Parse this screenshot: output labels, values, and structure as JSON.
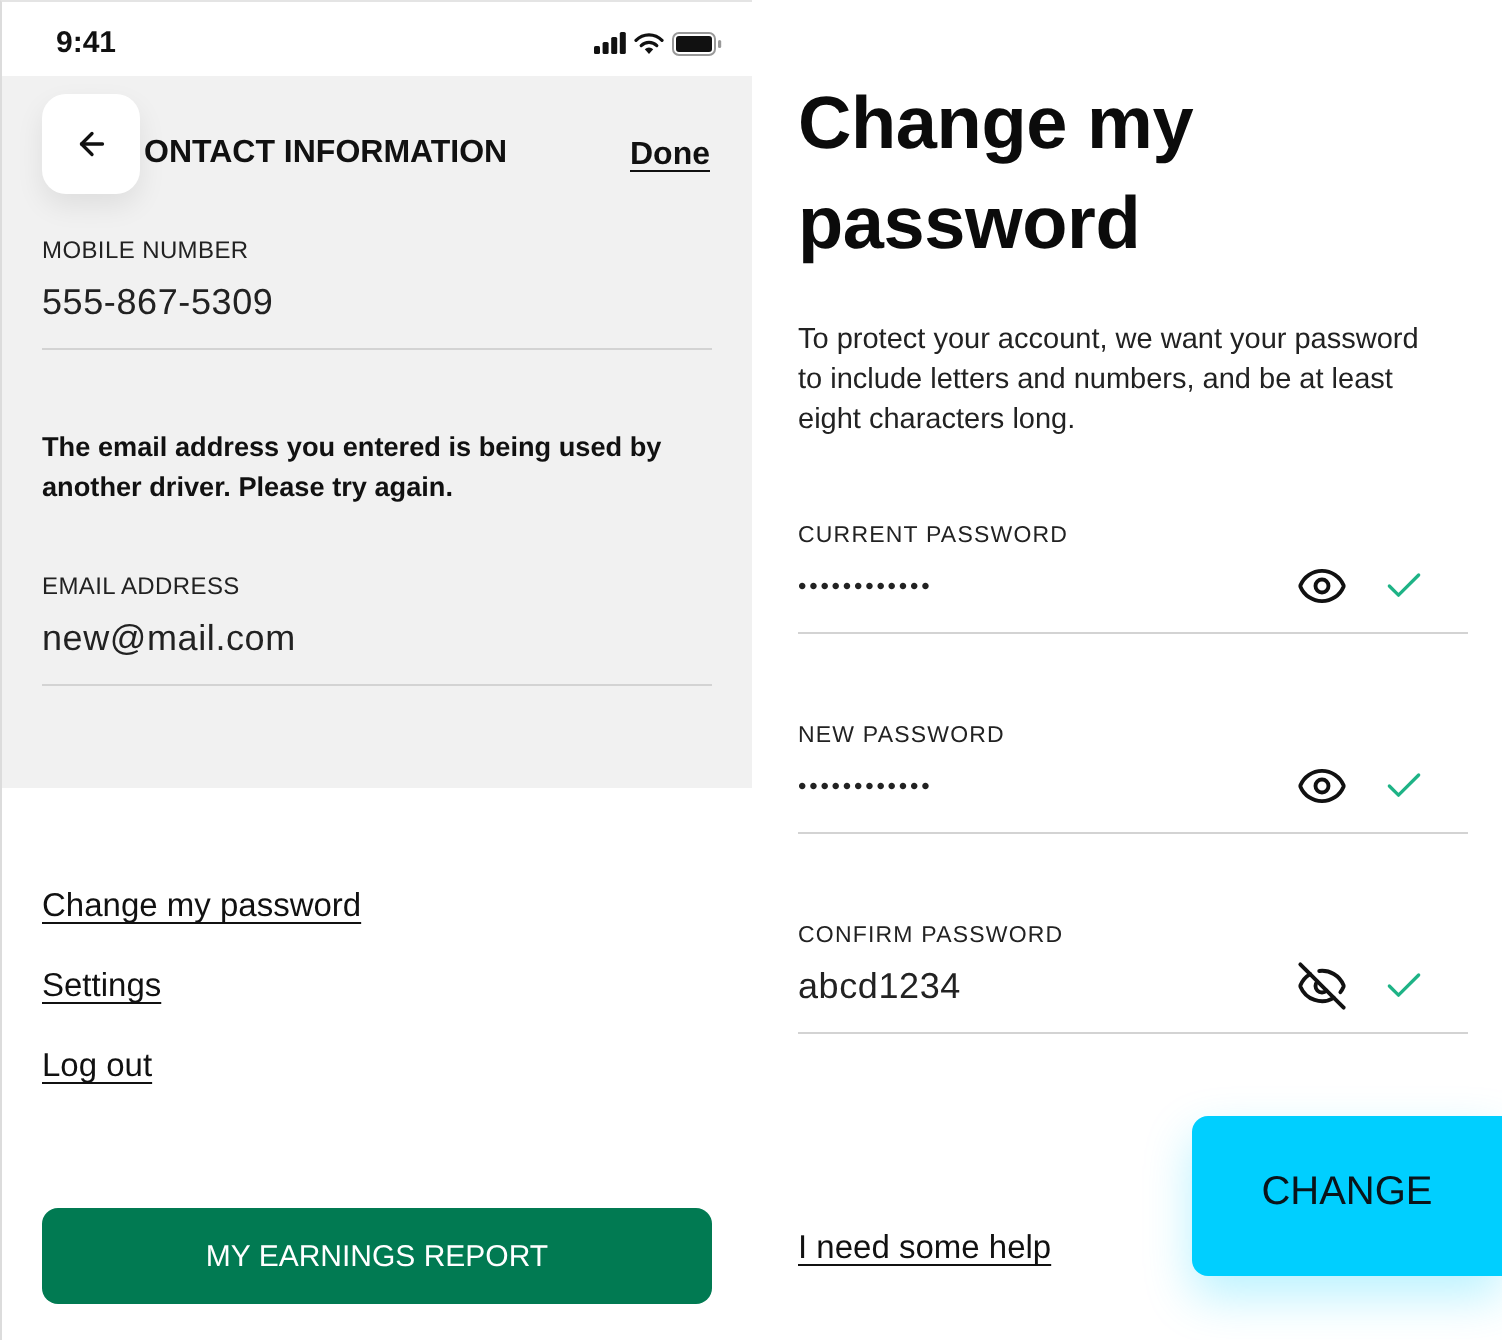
{
  "contact_screen": {
    "status_bar": {
      "time": "9:41"
    },
    "header": {
      "title": "ONTACT INFORMATION",
      "action": "Done"
    },
    "fields": [
      {
        "label": "MOBILE NUMBER",
        "value": "555-867-5309"
      },
      {
        "label": "EMAIL ADDRESS",
        "value": "new@mail.com",
        "error": "The email address you entered is being used by another driver. Please try again."
      }
    ],
    "links": [
      "Change my password",
      "Settings",
      "Log out"
    ],
    "primary_button": "MY EARNINGS REPORT"
  },
  "password_screen": {
    "title": "Change my password",
    "description": "To protect your account, we want your password to include letters and numbers, and be at least eight characters long.",
    "fields": [
      {
        "label": "CURRENT PASSWORD",
        "value": "••••••••••••",
        "revealed": false,
        "valid": true
      },
      {
        "label": "NEW PASSWORD",
        "value": "••••••••••••",
        "revealed": false,
        "valid": true
      },
      {
        "label": "CONFIRM PASSWORD",
        "value": "abcd1234",
        "revealed": true,
        "valid": true
      }
    ],
    "help_link": "I need some help",
    "submit_button": "CHANGE"
  }
}
